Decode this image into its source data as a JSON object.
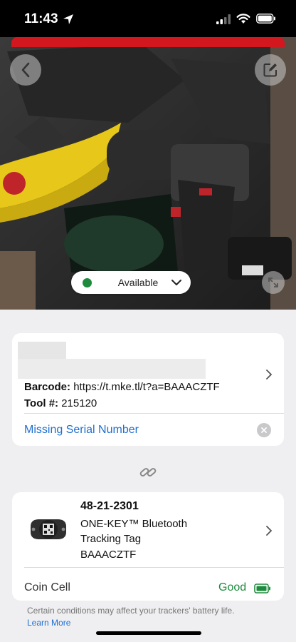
{
  "status_bar": {
    "time": "11:43"
  },
  "photo": {
    "status": "Available",
    "status_color": "#1e8a3c",
    "banner_color": "#d3171f"
  },
  "tool": {
    "barcode_label": "Barcode:",
    "barcode_value": "https://t.mke.tl/t?a=BAAACZTF",
    "tool_no_label": "Tool #:",
    "tool_no_value": "215120",
    "serial_link": "Missing Serial Number"
  },
  "tracker": {
    "part_number": "48-21-2301",
    "product_name": "ONE-KEY™ Bluetooth Tracking Tag",
    "tag_code": "BAAACZTF",
    "battery_type": "Coin Cell",
    "battery_status": "Good"
  },
  "footer": {
    "note": "Certain conditions may affect your trackers' battery life.",
    "learn_more": "Learn More"
  },
  "colors": {
    "link": "#1f6fd0",
    "good": "#1e8a3c"
  }
}
